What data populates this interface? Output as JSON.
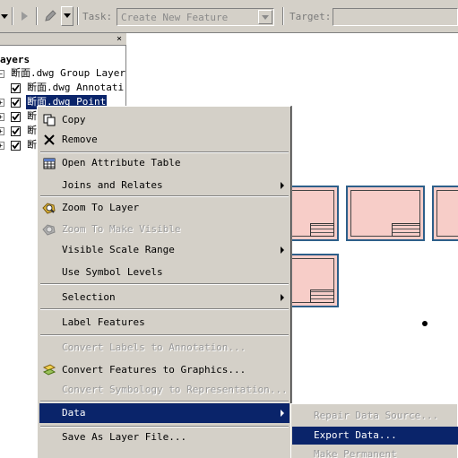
{
  "toolbar": {
    "task_label": "Task:",
    "task_value": "Create New Feature",
    "target_label": "Target:",
    "target_value": ""
  },
  "toc": {
    "header": "ayers",
    "close_glyph": "×",
    "rows": [
      {
        "label": "断面.dwg Group Layer"
      },
      {
        "label": "断面.dwg Annotati"
      },
      {
        "label": "断面.dwg Point"
      },
      {
        "label": "断"
      },
      {
        "label": "断"
      },
      {
        "label": "断"
      }
    ]
  },
  "context_menu": {
    "items": [
      {
        "label": "Copy",
        "icon": "copy-icon"
      },
      {
        "label": "Remove",
        "icon": "remove-icon"
      },
      {
        "label": "Open Attribute Table",
        "icon": "table-icon"
      },
      {
        "label": "Joins and Relates"
      },
      {
        "label": "Zoom To Layer",
        "icon": "zoom-to-layer-icon"
      },
      {
        "label": "Zoom To Make Visible",
        "icon": "zoom-visible-icon"
      },
      {
        "label": "Visible Scale Range"
      },
      {
        "label": "Use Symbol Levels"
      },
      {
        "label": "Selection"
      },
      {
        "label": "Label Features"
      },
      {
        "label": "Convert Labels to Annotation..."
      },
      {
        "label": "Convert Features to Graphics...",
        "icon": "convert-graphics-icon"
      },
      {
        "label": "Convert Symbology to Representation..."
      },
      {
        "label": "Data"
      },
      {
        "label": "Save As Layer File..."
      }
    ]
  },
  "submenu": {
    "items": [
      {
        "label": "Repair Data Source..."
      },
      {
        "label": "Export Data..."
      },
      {
        "label": "Make Permanent"
      }
    ]
  },
  "colors": {
    "highlight": "#0a246a",
    "menu_bg": "#d4d0c8",
    "sheet_fill": "#f7cdc8",
    "sheet_border": "#2d5f8a"
  }
}
